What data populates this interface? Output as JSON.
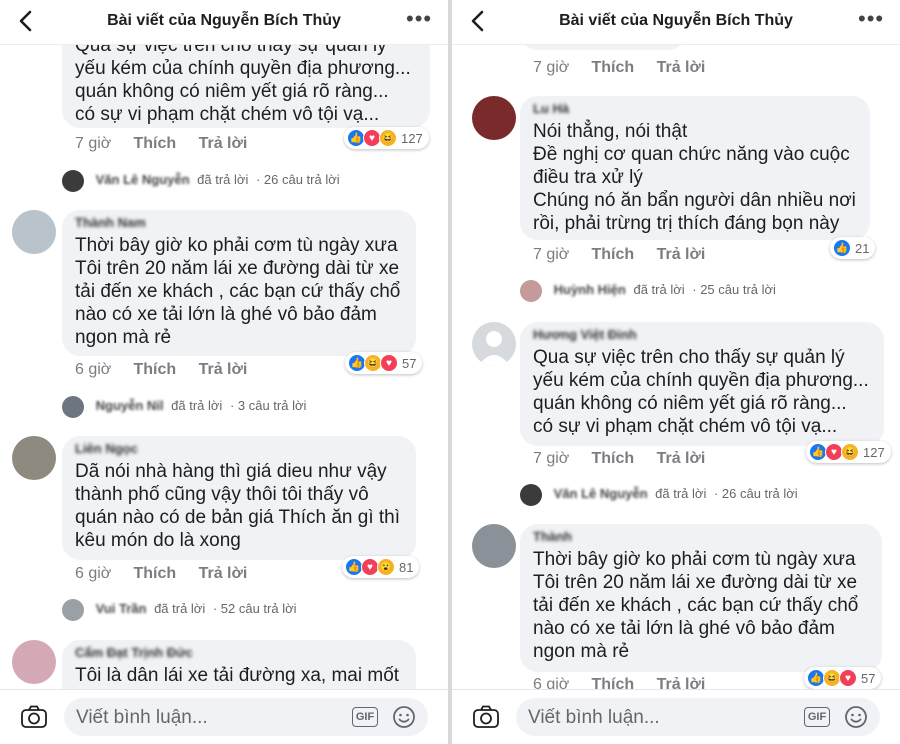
{
  "header": {
    "title": "Bài viết của Nguyễn Bích Thủy"
  },
  "composer": {
    "placeholder": "Viết bình luận...",
    "gif_label": "GIF"
  },
  "actions": {
    "like": "Thích",
    "reply": "Trả lời"
  },
  "reply_suffix": "đã trả lời",
  "left": {
    "c1": {
      "lines": [
        "Qua sự việc trên cho thấy sự quản lý",
        "yếu kém của chính quyền địa phương...",
        "quán không có niêm yết giá rõ ràng...",
        "có sự vi phạm chặt chém vô tội vạ..."
      ],
      "time": "7 giờ",
      "reactions": "127",
      "reply_name": "Văn Lê Nguyễn",
      "reply_count": "· 26 câu trả lời"
    },
    "c2": {
      "name": "Thành Nam",
      "lines": [
        "Thời bây giờ ko phải cơm tù ngày xưa",
        "Tôi trên 20 năm lái xe đường dài từ xe",
        "tải đến xe khách , các bạn cứ thấy chổ",
        "nào có xe tải lớn là ghé vô bảo đảm",
        "ngon mà rẻ"
      ],
      "time": "6 giờ",
      "reactions": "57",
      "reply_name": "Nguyễn Nil",
      "reply_count": "· 3 câu trả lời"
    },
    "c3": {
      "name": "Liên Ngọc",
      "lines": [
        "Dã nói nhà hàng thì giá dieu như vậy",
        "thành phố cũng vậy thôi tôi thấy vô",
        "quán nào có de bản giá Thích ăn gì thì",
        "kêu món do là xong"
      ],
      "time": "6 giờ",
      "reactions": "81",
      "reply_name": "Vui Trần",
      "reply_count": "· 52 câu trả lời"
    },
    "c4": {
      "name": "Cẩm Đạt Trịnh Đức",
      "lines": [
        "Tôi là dân lái xe tải đường xa, mai mốt"
      ]
    }
  },
  "right": {
    "c0": {
      "time": "7 giờ"
    },
    "c1": {
      "name": "Lu Hà",
      "lines": [
        "Nói thẳng, nói thật",
        "Đề nghị cơ quan chức năng vào cuộc",
        "điều tra xử lý",
        "Chúng nó ăn bẩn người dân nhiều nơi",
        "rồi, phải trừng trị thích đáng bọn này"
      ],
      "time": "7 giờ",
      "reactions": "21",
      "reply_name": "Huỳnh Hiện",
      "reply_count": "· 25 câu trả lời"
    },
    "c2": {
      "name": "Hương Việt Đinh",
      "lines": [
        "Qua sự việc trên cho thấy sự quản lý",
        "yếu kém của chính quyền địa phương...",
        "quán không có niêm yết giá rõ ràng...",
        "có sự vi phạm chặt chém vô tội vạ..."
      ],
      "time": "7 giờ",
      "reactions": "127",
      "reply_name": "Văn Lê Nguyễn",
      "reply_count": "· 26 câu trả lời"
    },
    "c3": {
      "name": "Thành",
      "lines": [
        "Thời bây giờ ko phải cơm tù ngày xưa",
        "Tôi trên 20 năm lái xe đường dài từ xe",
        "tải đến xe khách , các bạn cứ thấy chổ",
        "nào có xe tải lớn là ghé vô bảo đảm",
        "ngon mà rẻ"
      ],
      "time": "6 giờ",
      "reactions": "57"
    }
  },
  "colors": {
    "like": "#1877f2",
    "love": "#f33e58",
    "haha": "#f7b125",
    "bubble": "#f0f2f5"
  }
}
